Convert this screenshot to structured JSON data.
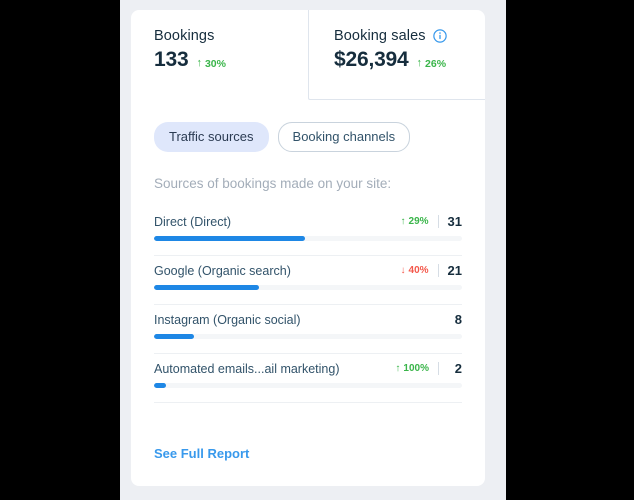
{
  "metrics": [
    {
      "label": "Bookings",
      "value": "133",
      "delta": "30%",
      "direction": "up",
      "arrow": "↑",
      "has_info_icon": false
    },
    {
      "label": "Booking sales",
      "value": "$26,394",
      "delta": "26%",
      "direction": "up",
      "arrow": "↑",
      "has_info_icon": true
    }
  ],
  "tabs": [
    {
      "label": "Traffic sources",
      "selected": true
    },
    {
      "label": "Booking channels",
      "selected": false
    }
  ],
  "subtitle": "Sources of bookings made on your site:",
  "rows": [
    {
      "name": "Direct (Direct)",
      "delta": "29%",
      "direction": "up",
      "arrow": "↑",
      "count": "31",
      "bar_percent": 49
    },
    {
      "name": "Google (Organic search)",
      "delta": "40%",
      "direction": "down",
      "arrow": "↓",
      "count": "21",
      "bar_percent": 34
    },
    {
      "name": "Instagram (Organic social)",
      "delta": "",
      "direction": "none",
      "arrow": "",
      "count": "8",
      "bar_percent": 13
    },
    {
      "name": "Automated emails...ail marketing)",
      "delta": "100%",
      "direction": "up",
      "arrow": "↑",
      "count": "2",
      "bar_percent": 4
    }
  ],
  "footer": {
    "report_link": "See Full Report"
  },
  "colors": {
    "bar_fill": "#1e87e5",
    "bar_track": "#f4f6f8",
    "up": "#3ab54a",
    "down": "#f4584b",
    "link": "#3899ec",
    "tab_selected_bg": "#dfe7fb",
    "page_bg": "#edeff3",
    "card_bg": "#ffffff"
  },
  "icons": {
    "info": "info-icon"
  }
}
